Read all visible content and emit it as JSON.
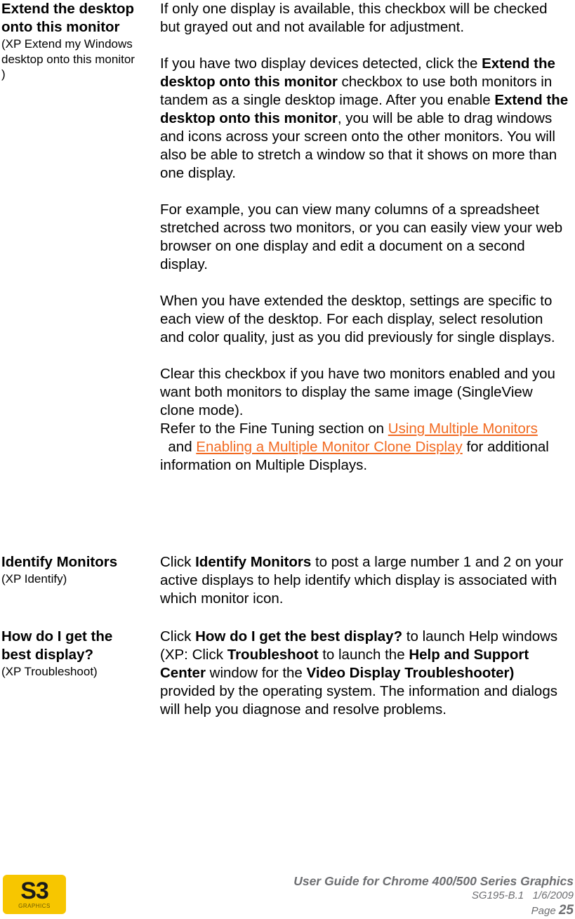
{
  "sections": [
    {
      "term": "Extend the desktop onto this monitor",
      "term_sub": "(XP Extend my Windows desktop onto this monitor )",
      "p1": "If only one display is available, this checkbox will be checked but grayed out and not available for adjustment.",
      "p2_a": "If you have two display devices detected, click the ",
      "p2_b": "Extend the desktop onto this monitor",
      "p2_c": " checkbox to use both monitors in tandem as a single desktop image. After you enable ",
      "p2_d": "Extend the desktop onto this monitor",
      "p2_e": ", you will be able to drag windows and icons across your screen onto the other monitors. You will also be able to stretch a window so that it shows on more than one display.",
      "p3": "For example, you can view many columns of a spreadsheet stretched across two monitors, or you can easily view your web browser on one display and edit a document on a second display.",
      "p4": "When you have extended the desktop, settings are specific to each view of the desktop. For each display, select resolution and color quality, just as you did previously for single displays.",
      "p5": "Clear this checkbox if you have two monitors enabled and you want both monitors to display the same image (SingleView clone mode).",
      "p6_a": "Refer to the Fine Tuning section on ",
      "p6_link1": "Using Multiple Monitors",
      "p6_b": "  and ",
      "p6_link2": "Enabling a Multiple Monitor Clone Display",
      "p6_c": " for additional information on Multiple Displays."
    },
    {
      "term": "Identify Monitors",
      "term_sub": "(XP Identify)",
      "d_a": "Click ",
      "d_b": "Identify Monitors",
      "d_c": " to post a large number 1 and 2 on your active displays to help identify which display is associated with which monitor icon."
    },
    {
      "term": "How do I get the best display?",
      "term_sub": "(XP Troubleshoot)",
      "d_a": "Click ",
      "d_b": "How do I get the best display?",
      "d_c": " to launch Help windows (XP: Click ",
      "d_d": "Troubleshoot",
      "d_e": " to launch the ",
      "d_f": "Help and Support Center",
      "d_g": " window for the ",
      "d_h": "Video Display Troubleshooter)",
      "d_i": " provided by the operating system. The information and dialogs will help you diagnose and resolve problems."
    }
  ],
  "footer": {
    "logo_text": "S3",
    "logo_sub": "GRAPHICS",
    "title": "User Guide for Chrome 400/500 Series Graphics",
    "doc_id": "SG195-B.1   1/6/2009",
    "page_label": "Page ",
    "page_number": "25"
  },
  "colors": {
    "link": "#f26a21",
    "footer_text": "#6d6e71",
    "logo_bg": "#f7c600"
  }
}
